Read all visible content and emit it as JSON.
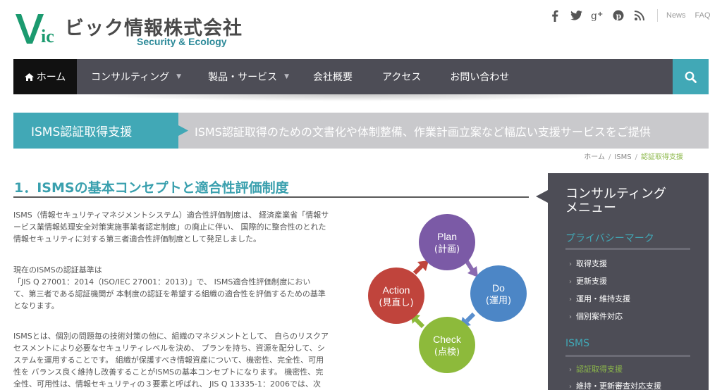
{
  "header": {
    "company_name": "ビック情報株式会社",
    "tagline": "Security & Ecology",
    "logo_mark_text": "Vic",
    "links": {
      "news": "News",
      "faq": "FAQ"
    }
  },
  "social": [
    "facebook-icon",
    "twitter-icon",
    "google-plus-icon",
    "pinterest-icon",
    "rss-icon"
  ],
  "nav": {
    "home": "ホーム",
    "consulting": "コンサルティング",
    "products": "製品・サービス",
    "company": "会社概要",
    "access": "アクセス",
    "contact": "お問い合わせ"
  },
  "banner": {
    "title": "ISMS認証取得支援",
    "subtitle": "ISMS認証取得のための文書化や体制整備、作業計画立案など幅広い支援サービスをご提供"
  },
  "breadcrumb": {
    "home": "ホーム",
    "isms": "ISMS",
    "current": "認証取得支援"
  },
  "main": {
    "heading": "1．ISMSの基本コンセプトと適合性評価制度",
    "p1": [
      "ISMS（情報セキュリティマネジメントシステム）適合性評価制度は、 経済産業省「情報サ",
      "ービス業情報処理安全対策実施事業者認定制度」の廃止に伴い、 国際的に整合性のとれた",
      "情報セキュリティに対する第三者適合性評価制度として発足しました。"
    ],
    "p2": [
      "現在のISMSの認証基準は",
      "「JIS Q 27001：2014（ISO/IEC 27001：2013）」で、 ISMS適合性評価制度におい",
      "て、第三者である認証機関が 本制度の認証を希望する組織の適合性を評価するための基準",
      "となります。"
    ],
    "p3": [
      "ISMSとは、個別の問題毎の技術対策の他に、組織のマネジメントとして、 自らのリスクア",
      "セスメントにより必要なセキュリティレベルを決め、 プランを持ち、資源を配分して、シ",
      "ステムを運用することです。 組織が保護すべき情報資産について、機密性、完全性、可用",
      "性を バランス良く維持し改善することがISMSの基本コンセプトになります。 機密性、完",
      "全性、可用性は、情報セキュリティの３要素と呼ばれ、 JIS Q 13335-1：2006では、次"
    ]
  },
  "pdca": {
    "plan": [
      "Plan",
      "(計画)"
    ],
    "do": [
      "Do",
      "(運用)"
    ],
    "check": [
      "Check",
      "(点検)"
    ],
    "action": [
      "Action",
      "(見直し)"
    ],
    "colors": {
      "plan": "#7b5aa6",
      "do": "#4c86c6",
      "check": "#8dba3b",
      "action": "#c0443c",
      "arrow": "#8a6ab0"
    }
  },
  "sidebar": {
    "title": [
      "コンサルティング",
      "メニュー"
    ],
    "privacy_mark": "プライバシーマーク",
    "privacy_items": [
      "取得支援",
      "更新支援",
      "運用・維持支援",
      "個別案件対応"
    ],
    "isms": "ISMS",
    "isms_items": [
      "認証取得支援",
      "維持・更新審査対応支援"
    ]
  },
  "colors": {
    "accent": "#41a8b6",
    "nav": "#4d4d56",
    "highlight": "#8cb84a"
  }
}
